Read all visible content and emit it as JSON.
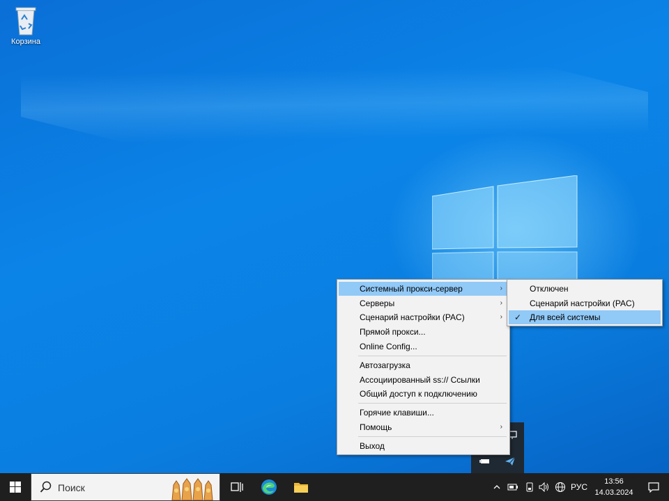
{
  "desktop": {
    "icons": [
      {
        "name": "recycle-bin",
        "label": "Корзина"
      }
    ]
  },
  "context_menu": {
    "items": [
      {
        "label": "Системный прокси-сервер",
        "has_submenu": true,
        "highlighted": true
      },
      {
        "label": "Серверы",
        "has_submenu": true
      },
      {
        "label": "Сценарий настройки (PAC)",
        "has_submenu": true
      },
      {
        "label": "Прямой прокси..."
      },
      {
        "label": "Online Config..."
      },
      {
        "label": "Автозагрузка"
      },
      {
        "label": "Ассоциированный ss:// Ссылки"
      },
      {
        "label": "Общий доступ к подключению"
      },
      {
        "label": "Горячие клавиши..."
      },
      {
        "label": "Помощь",
        "has_submenu": true
      },
      {
        "label": "Выход"
      }
    ],
    "arrow_glyph": "›"
  },
  "submenu": {
    "items": [
      {
        "label": "Отключен",
        "checked": false
      },
      {
        "label": "Сценарий настройки (PAC)",
        "checked": false
      },
      {
        "label": "Для всей системы",
        "checked": true,
        "highlighted": true
      }
    ],
    "check_glyph": "✓"
  },
  "taskbar": {
    "search_placeholder": "Поиск",
    "pinned": [
      "task-view",
      "edge",
      "file-explorer"
    ],
    "tray": {
      "language": "РУС",
      "time": "13:56",
      "date": "14.03.2024"
    }
  },
  "colors": {
    "wallpaper": "#0a7ee0",
    "menu_bg": "#f2f2f2",
    "highlight": "#91c9f7",
    "taskbar": "#1f1f1f"
  }
}
